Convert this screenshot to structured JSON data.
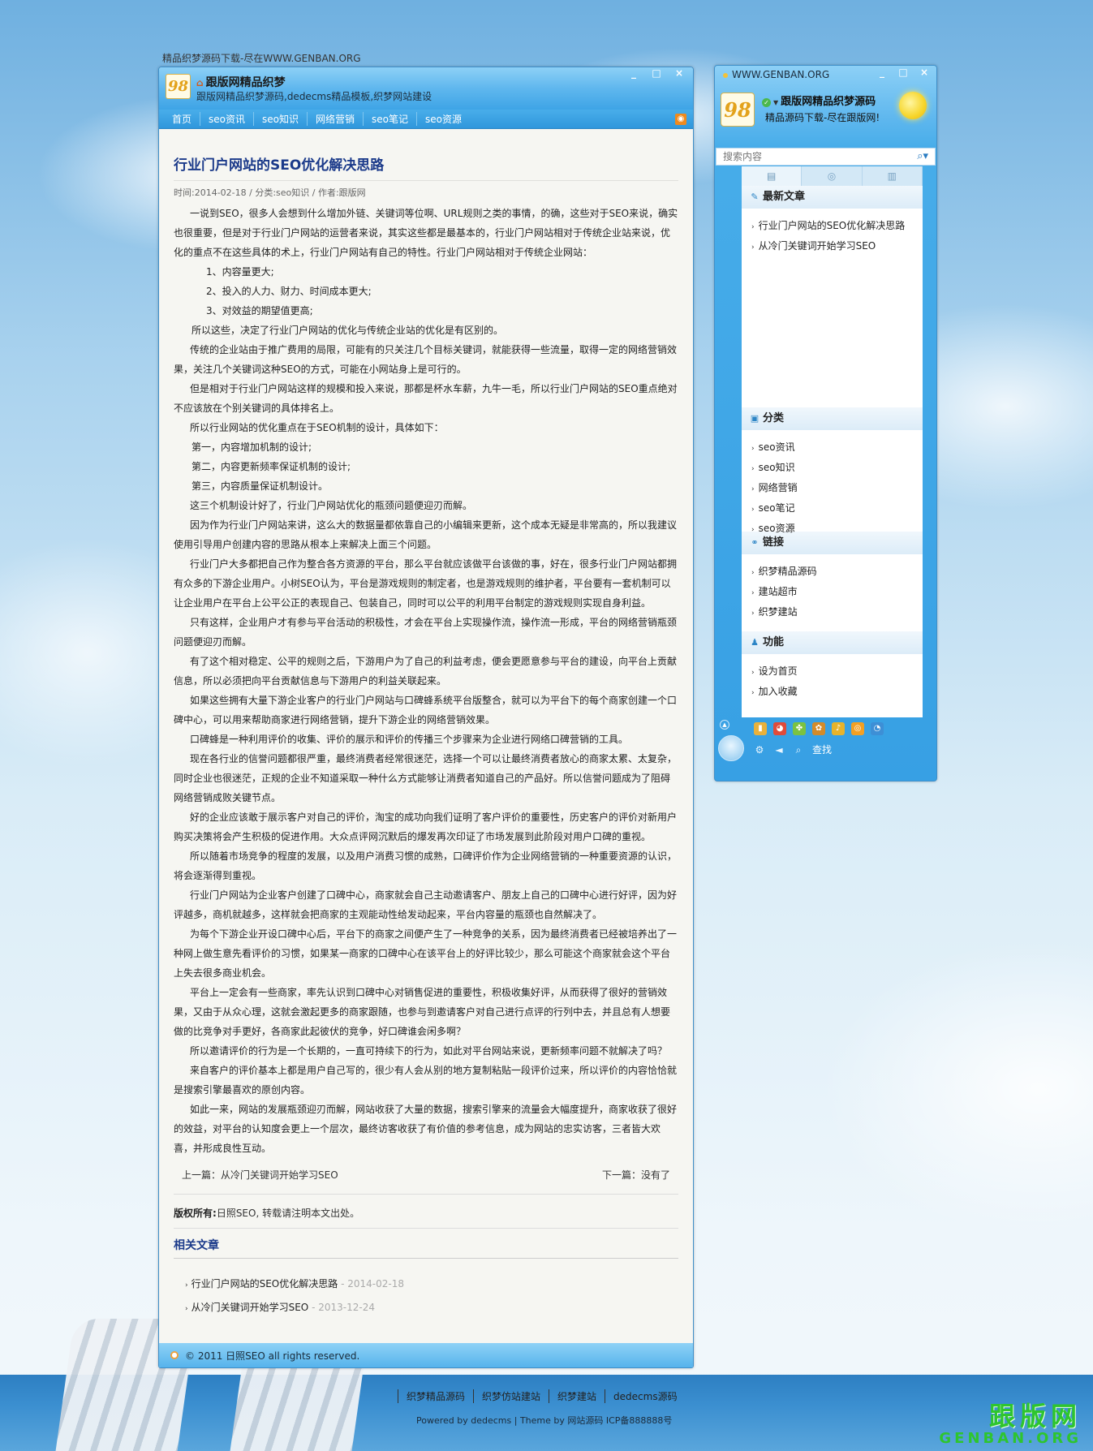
{
  "top_caption": "精品织梦源码下载-尽在WWW.GENBAN.ORG",
  "main": {
    "title": "跟版网精品织梦",
    "subtitle": "跟版网精品织梦源码,dedecms精品模板,织梦网站建设",
    "logo_text": "98",
    "window_controls": [
      "_",
      "□",
      "×"
    ],
    "nav": [
      "首页",
      "seo资讯",
      "seo知识",
      "网络营销",
      "seo笔记",
      "seo资源"
    ],
    "article": {
      "title": "行业门户网站的SEO优化解决思路",
      "meta": "时间:2014-02-18 / 分类:seo知识 / 作者:跟版网",
      "paragraphs": [
        "一说到SEO，很多人会想到什么增加外链、关键词等位啊、URL规则之类的事情，的确，这些对于SEO来说，确实也很重要，但是对于行业门户网站的运营者来说，其实这些都是最基本的，行业门户网站相对于传统企业站来说，优化的重点不在这些具体的术上，行业门户网站有自己的特性。行业门户网站相对于传统企业网站：",
        "1、内容量更大;",
        "2、投入的人力、财力、时间成本更大;",
        "3、对效益的期望值更高;",
        "所以这些，决定了行业门户网站的优化与传统企业站的优化是有区别的。",
        "传统的企业站由于推广费用的局限，可能有的只关注几个目标关键词，就能获得一些流量，取得一定的网络营销效果，关注几个关键词这种SEO的方式，可能在小网站身上是可行的。",
        "但是相对于行业门户网站这样的规模和投入来说，那都是杯水车薪，九牛一毛，所以行业门户网站的SEO重点绝对不应该放在个别关键词的具体排名上。",
        "所以行业网站的优化重点在于SEO机制的设计，具体如下：",
        "第一，内容增加机制的设计;",
        "第二，内容更新频率保证机制的设计;",
        "第三，内容质量保证机制设计。",
        "这三个机制设计好了，行业门户网站优化的瓶颈问题便迎刃而解。",
        "因为作为行业门户网站来讲，这么大的数据量都依靠自己的小编辑来更新，这个成本无疑是非常高的，所以我建议使用引导用户创建内容的思路从根本上来解决上面三个问题。",
        "行业门户大多都把自己作为整合各方资源的平台，那么平台就应该做平台该做的事，好在，很多行业门户网站都拥有众多的下游企业用户。小树SEO认为，平台是游戏规则的制定者，也是游戏规则的维护者，平台要有一套机制可以让企业用户在平台上公平公正的表现自己、包装自己，同时可以公平的利用平台制定的游戏规则实现自身利益。",
        "只有这样，企业用户才有参与平台活动的积极性，才会在平台上实现操作流，操作流一形成，平台的网络营销瓶颈问题便迎刃而解。",
        "有了这个相对稳定、公平的规则之后，下游用户为了自己的利益考虑，便会更愿意参与平台的建设，向平台上贡献信息，所以必须把向平台贡献信息与下游用户的利益关联起来。",
        "如果这些拥有大量下游企业客户的行业门户网站与口碑蜂系统平台版整合，就可以为平台下的每个商家创建一个口碑中心，可以用来帮助商家进行网络营销，提升下游企业的网络营销效果。",
        "口碑蜂是一种利用评价的收集、评价的展示和评价的传播三个步骤来为企业进行网络口碑营销的工具。",
        "现在各行业的信誉问题都很严重，最终消费者经常很迷茫，选择一个可以让最终消费者放心的商家太累、太复杂，同时企业也很迷茫，正规的企业不知道采取一种什么方式能够让消费者知道自己的产品好。所以信誉问题成为了阻碍网络营销成败关键节点。",
        "好的企业应该敢于展示客户对自己的评价，淘宝的成功向我们证明了客户评价的重要性，历史客户的评价对新用户购买决策将会产生积极的促进作用。大众点评网沉默后的爆发再次印证了市场发展到此阶段对用户口碑的重视。",
        "所以随着市场竞争的程度的发展，以及用户消费习惯的成熟，口碑评价作为企业网络营销的一种重要资源的认识，将会逐渐得到重视。",
        "行业门户网站为企业客户创建了口碑中心，商家就会自己主动邀请客户、朋友上自己的口碑中心进行好评，因为好评越多，商机就越多，这样就会把商家的主观能动性给发动起来，平台内容量的瓶颈也自然解决了。",
        "为每个下游企业开设口碑中心后，平台下的商家之间便产生了一种竞争的关系，因为最终消费者已经被培养出了一种网上做生意先看评价的习惯，如果某一商家的口碑中心在该平台上的好评比较少，那么可能这个商家就会这个平台上失去很多商业机会。",
        "平台上一定会有一些商家，率先认识到口碑中心对销售促进的重要性，积极收集好评，从而获得了很好的营销效果，又由于从众心理，这就会激起更多的商家跟随，也参与到邀请客户对自己进行点评的行列中去，并且总有人想要做的比竞争对手更好，各商家此起彼伏的竞争，好口碑谁会闲多啊？",
        "所以邀请评价的行为是一个长期的，一直可持续下的行为，如此对平台网站来说，更新频率问题不就解决了吗？",
        "来自客户的评价基本上都是用户自己写的，很少有人会从别的地方复制粘贴一段评价过来，所以评价的内容恰恰就是搜索引擎最喜欢的原创内容。",
        "如此一来，网站的发展瓶颈迎刃而解，网站收获了大量的数据，搜索引擎来的流量会大幅度提升，商家收获了很好的效益，对平台的认知度会更上一个层次，最终访客收获了有价值的参考信息，成为网站的忠实访客，三者皆大欢喜，并形成良性互动。"
      ],
      "prev": "上一篇：从冷门关键词开始学习SEO",
      "next": "下一篇：没有了",
      "copyright_label": "版权所有:",
      "copyright_text": "日照SEO, 转载请注明本文出处。",
      "related_title": "相关文章",
      "related": [
        {
          "title": "行业门户网站的SEO优化解决思路",
          "date": " - 2014-02-18"
        },
        {
          "title": "从冷门关键词开始学习SEO",
          "date": " - 2013-12-24"
        }
      ]
    },
    "footer": "© 2011 日照SEO all rights reserved."
  },
  "side": {
    "caption": "WWW.GENBAN.ORG",
    "window_controls": [
      "_",
      "□",
      "×"
    ],
    "logo_text": "98",
    "name": "跟版网精品织梦源码",
    "desc": "精品源码下载-尽在跟版网!",
    "search_placeholder": "搜索内容",
    "tabs": [
      "▤",
      "◎",
      "▥"
    ],
    "sections": [
      {
        "title": "最新文章",
        "icon": "✎",
        "items": [
          "行业门户网站的SEO优化解决思路",
          "从冷门关键词开始学习SEO"
        ]
      },
      {
        "title": "分类",
        "icon": "▣",
        "items": [
          "seo资讯",
          "seo知识",
          "网络营销",
          "seo笔记",
          "seo资源"
        ]
      },
      {
        "title": "链接",
        "icon": "⚭",
        "items": [
          "织梦精品源码",
          "建站超市",
          "织梦建站"
        ]
      },
      {
        "title": "功能",
        "icon": "♟",
        "items": [
          "设为首页",
          "加入收藏"
        ]
      }
    ],
    "find_label": "查找"
  },
  "footer_links": [
    "织梦精品源码",
    "织梦仿站建站",
    "织梦建站",
    "dedecms源码"
  ],
  "powered": "Powered by dedecms | Theme by 网站源码 ICP备888888号",
  "brand": {
    "cn": "跟版网",
    "en": "GENBAN.ORG"
  },
  "colors": {
    "accent": "#3ea4e6",
    "title": "#1b3a8a",
    "brand_green": "#2ec52e"
  }
}
